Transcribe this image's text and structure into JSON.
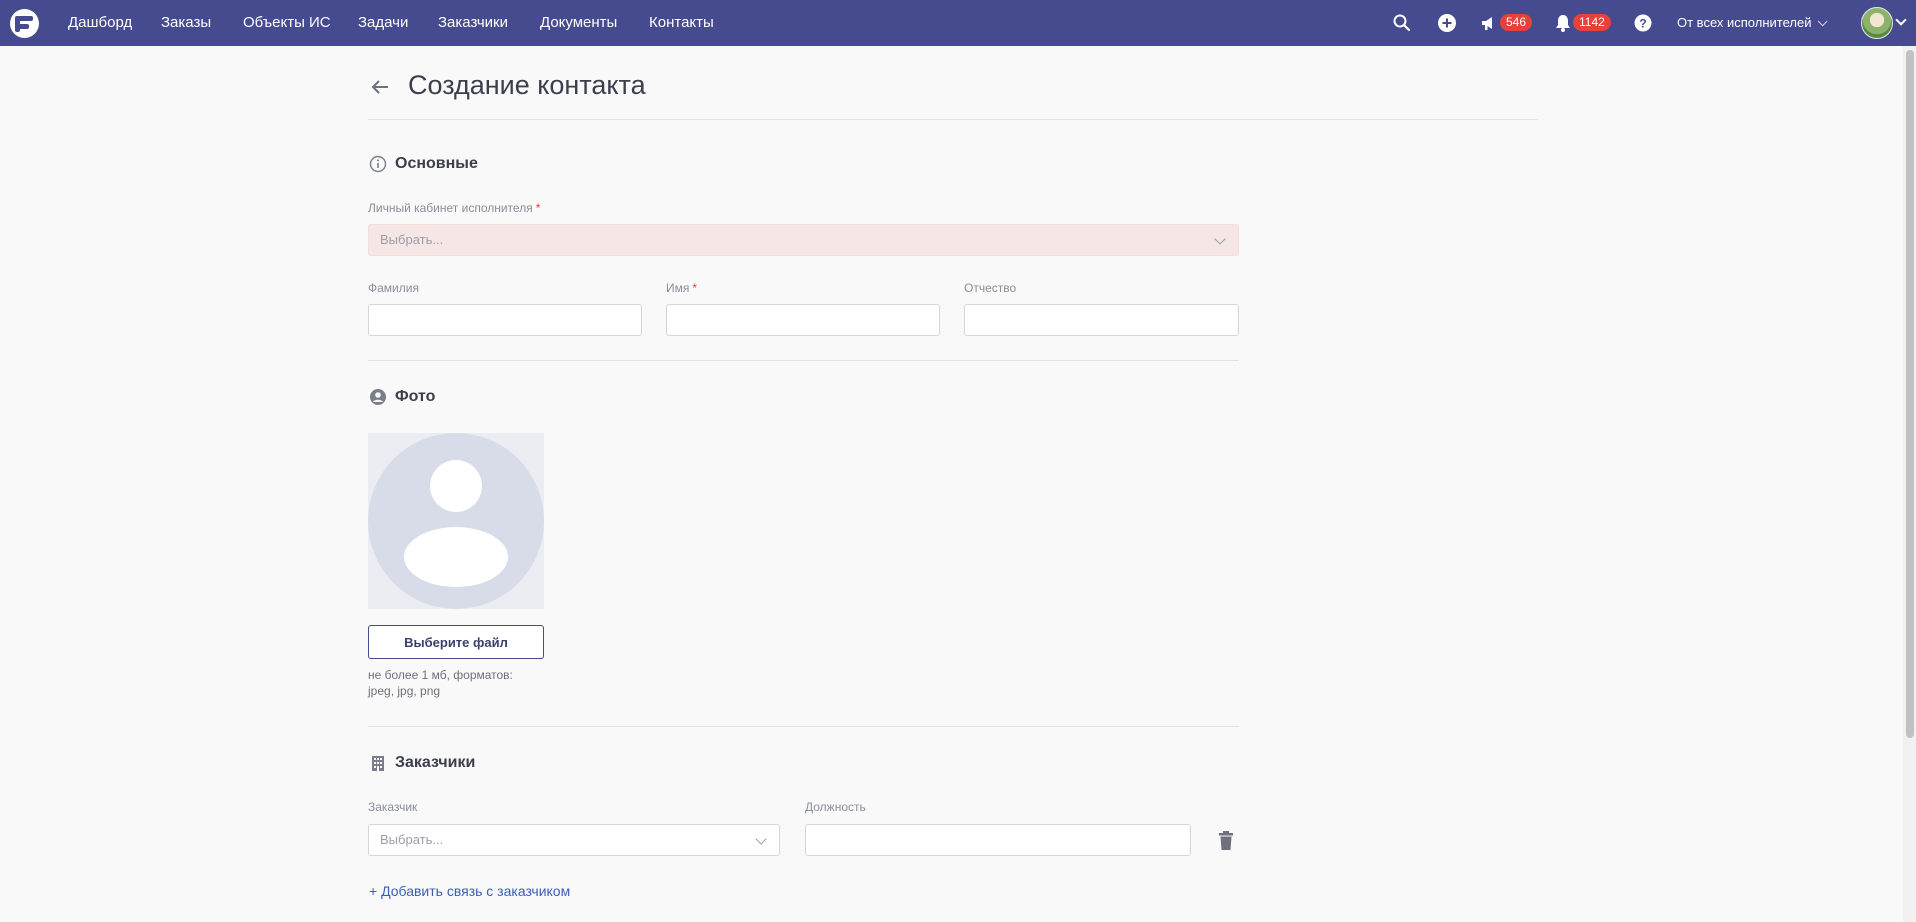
{
  "nav": {
    "items": [
      {
        "label": "Дашборд"
      },
      {
        "label": "Заказы"
      },
      {
        "label": "Объекты ИС"
      },
      {
        "label": "Задачи"
      },
      {
        "label": "Заказчики"
      },
      {
        "label": "Документы"
      },
      {
        "label": "Контакты"
      }
    ],
    "icons": [
      "search-icon",
      "add-circle-icon",
      "megaphone-icon",
      "bell-icon",
      "help-icon"
    ],
    "announcements_count": "546",
    "notifications_count": "1142",
    "performer_filter": "От всех исполнителей",
    "brand_color": "#464a8f",
    "badge_color": "#e8413c"
  },
  "page": {
    "title": "Создание контакта"
  },
  "sections": {
    "main": {
      "title": "Основные",
      "icon": "info-icon",
      "cabinet_label": "Личный кабинет исполнителя",
      "cabinet_placeholder": "Выбрать...",
      "required_mark": "*",
      "lastname_label": "Фамилия",
      "lastname_value": "",
      "firstname_label": "Имя",
      "firstname_value": "",
      "patronymic_label": "Отчество",
      "patronymic_value": ""
    },
    "photo": {
      "title": "Фото",
      "icon": "user-circle-icon",
      "button_label": "Выберите файл",
      "hint_line1": "не более 1 мб, форматов:",
      "hint_line2": "jpeg, jpg, png"
    },
    "customers": {
      "title": "Заказчики",
      "icon": "building-icon",
      "customer_label": "Заказчик",
      "customer_placeholder": "Выбрать...",
      "position_label": "Должность",
      "position_value": "",
      "add_link": "+ Добавить связь с заказчиком"
    }
  }
}
